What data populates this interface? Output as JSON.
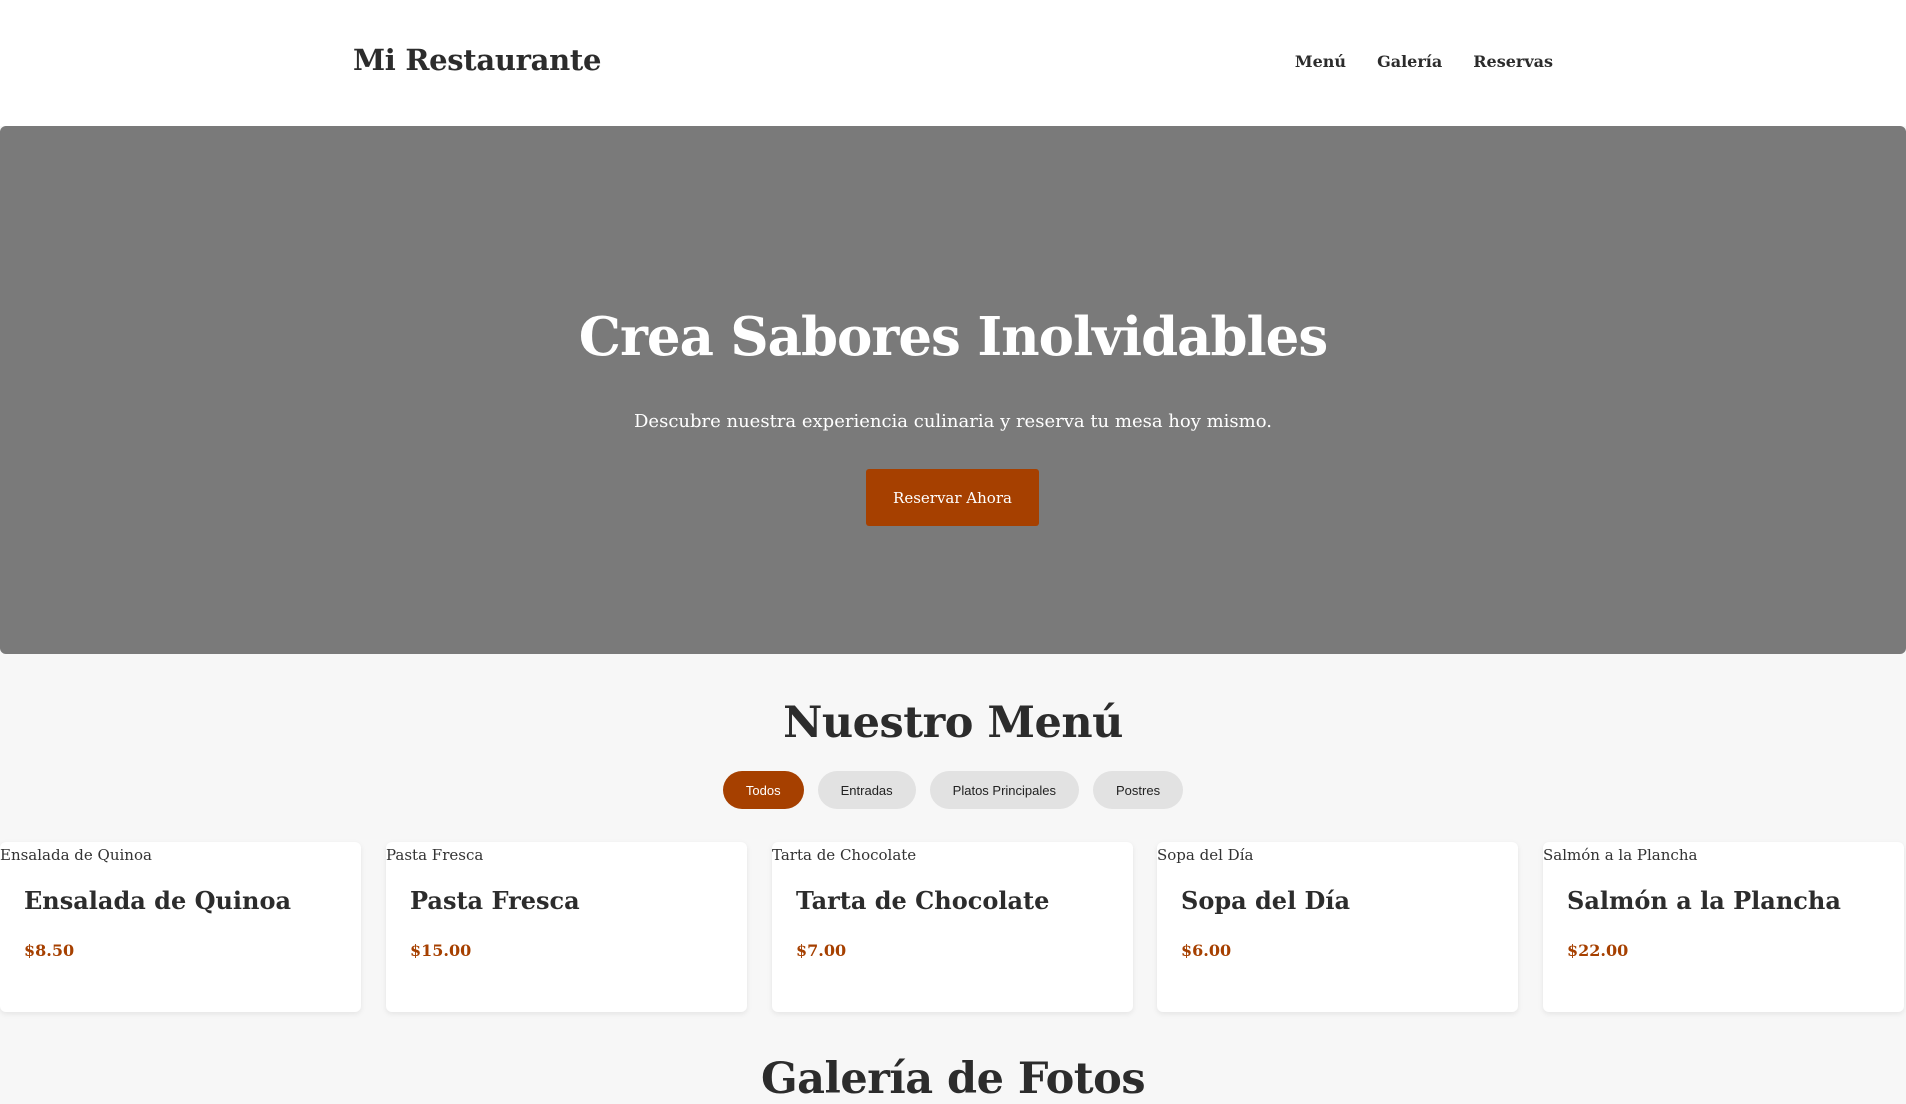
{
  "header": {
    "brand": "Mi Restaurante",
    "nav": [
      {
        "label": "Menú"
      },
      {
        "label": "Galería"
      },
      {
        "label": "Reservas"
      }
    ]
  },
  "hero": {
    "title": "Crea Sabores Inolvidables",
    "subtitle": "Descubre nuestra experiencia culinaria y reserva tu mesa hoy mismo.",
    "cta_label": "Reservar Ahora"
  },
  "menu": {
    "title": "Nuestro Menú",
    "filters": [
      {
        "label": "Todos",
        "active": true
      },
      {
        "label": "Entradas",
        "active": false
      },
      {
        "label": "Platos Principales",
        "active": false
      },
      {
        "label": "Postres",
        "active": false
      }
    ],
    "items": [
      {
        "image_alt": "Ensalada de Quinoa",
        "name": "Ensalada de Quinoa",
        "price": "$8.50"
      },
      {
        "image_alt": "Pasta Fresca",
        "name": "Pasta Fresca",
        "price": "$15.00"
      },
      {
        "image_alt": "Tarta de Chocolate",
        "name": "Tarta de Chocolate",
        "price": "$7.00"
      },
      {
        "image_alt": "Sopa del Día",
        "name": "Sopa del Día",
        "price": "$6.00"
      },
      {
        "image_alt": "Salmón a la Plancha",
        "name": "Salmón a la Plancha",
        "price": "$22.00"
      }
    ]
  },
  "gallery": {
    "title": "Galería de Fotos"
  },
  "colors": {
    "accent": "#a64000",
    "hero_bg": "#7a7a7a",
    "page_bg": "#f7f7f7"
  }
}
